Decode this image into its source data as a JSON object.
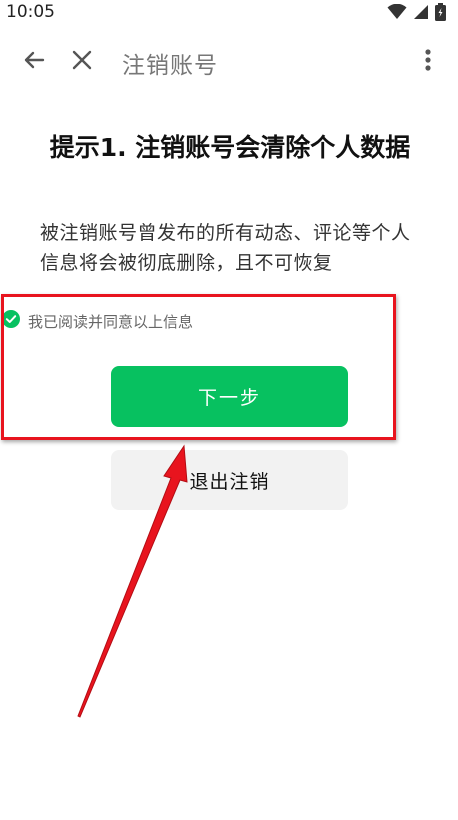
{
  "status_bar": {
    "time": "10:05",
    "icons": [
      "wifi-icon",
      "signal-icon",
      "battery-icon"
    ]
  },
  "app_bar": {
    "title": "注销账号",
    "back_icon": "arrow-left-icon",
    "close_icon": "close-icon",
    "more_icon": "more-vertical-icon"
  },
  "content": {
    "headline": "提示1. 注销账号会清除个人数据",
    "description": "被注销账号曾发布的所有动态、评论等个人信息将会被彻底删除，且不可恢复"
  },
  "agreement": {
    "checked": true,
    "text": "我已阅读并同意以上信息"
  },
  "buttons": {
    "next_label": "下一步",
    "exit_label": "退出注销"
  },
  "colors": {
    "primary_green": "#07c160",
    "secondary_bg": "#f2f2f2",
    "annotation_red": "#e8141e"
  }
}
